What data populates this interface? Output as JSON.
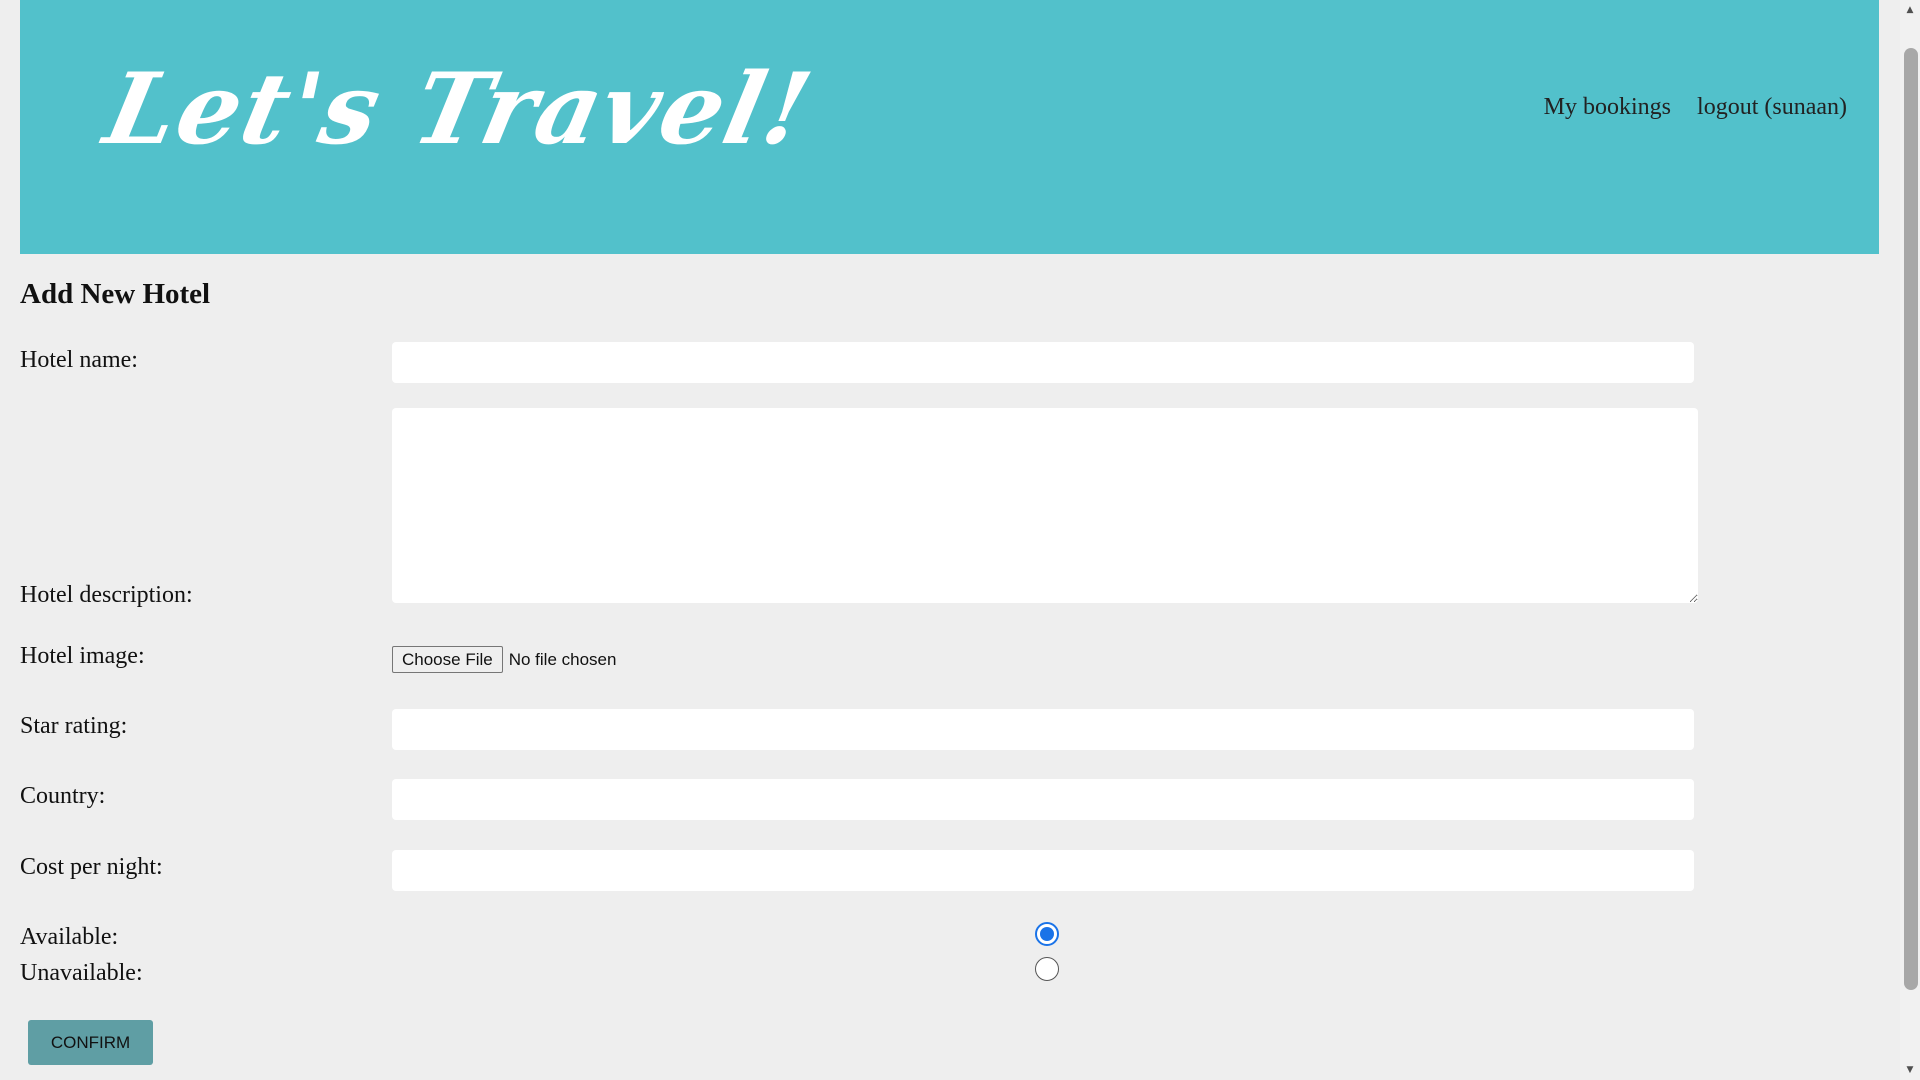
{
  "header": {
    "logo_text": "Let's Travel!",
    "nav": {
      "my_bookings": "My bookings",
      "logout": "logout (sunaan)"
    }
  },
  "form": {
    "title": "Add New Hotel",
    "hotel_name": {
      "label": "Hotel name:",
      "value": ""
    },
    "hotel_description": {
      "label": "Hotel description:",
      "value": ""
    },
    "hotel_image": {
      "label": "Hotel image:",
      "button_label": "Choose File",
      "status": "No file chosen"
    },
    "star_rating": {
      "label": "Star rating:",
      "value": ""
    },
    "country": {
      "label": "Country:",
      "value": ""
    },
    "cost_per_night": {
      "label": "Cost per night:",
      "value": ""
    },
    "availability": {
      "available_label": "Available:",
      "unavailable_label": "Unavailable:",
      "selected": "available"
    },
    "confirm_label": "CONFIRM"
  },
  "scrollbar": {
    "up_icon": "triangle-up",
    "down_icon": "triangle-down"
  },
  "colors": {
    "header_bg": "#52c1cb",
    "page_bg": "#eeeeee",
    "confirm_bg": "#5f9ea4",
    "radio_accent": "#1a73e8"
  }
}
